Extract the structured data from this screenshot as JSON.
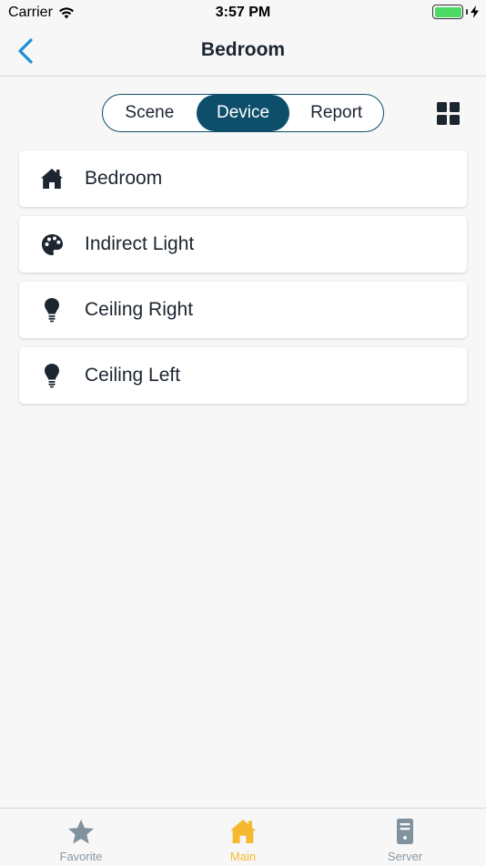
{
  "status_bar": {
    "carrier": "Carrier",
    "time": "3:57 PM"
  },
  "nav": {
    "title": "Bedroom"
  },
  "segments": [
    {
      "label": "Scene",
      "active": false
    },
    {
      "label": "Device",
      "active": true
    },
    {
      "label": "Report",
      "active": false
    }
  ],
  "devices": [
    {
      "label": "Bedroom",
      "icon": "home-icon"
    },
    {
      "label": "Indirect Light",
      "icon": "palette-icon"
    },
    {
      "label": "Ceiling Right",
      "icon": "lightbulb-icon"
    },
    {
      "label": "Ceiling Left",
      "icon": "lightbulb-icon"
    }
  ],
  "tabs": [
    {
      "label": "Favorite",
      "icon": "star-icon",
      "active": false
    },
    {
      "label": "Main",
      "icon": "home-icon",
      "active": true
    },
    {
      "label": "Server",
      "icon": "server-icon",
      "active": false
    }
  ],
  "colors": {
    "accent": "#0d4f6b",
    "tab_active": "#f5b82e",
    "tab_inactive": "#7f929e",
    "back": "#1e8ed6"
  }
}
